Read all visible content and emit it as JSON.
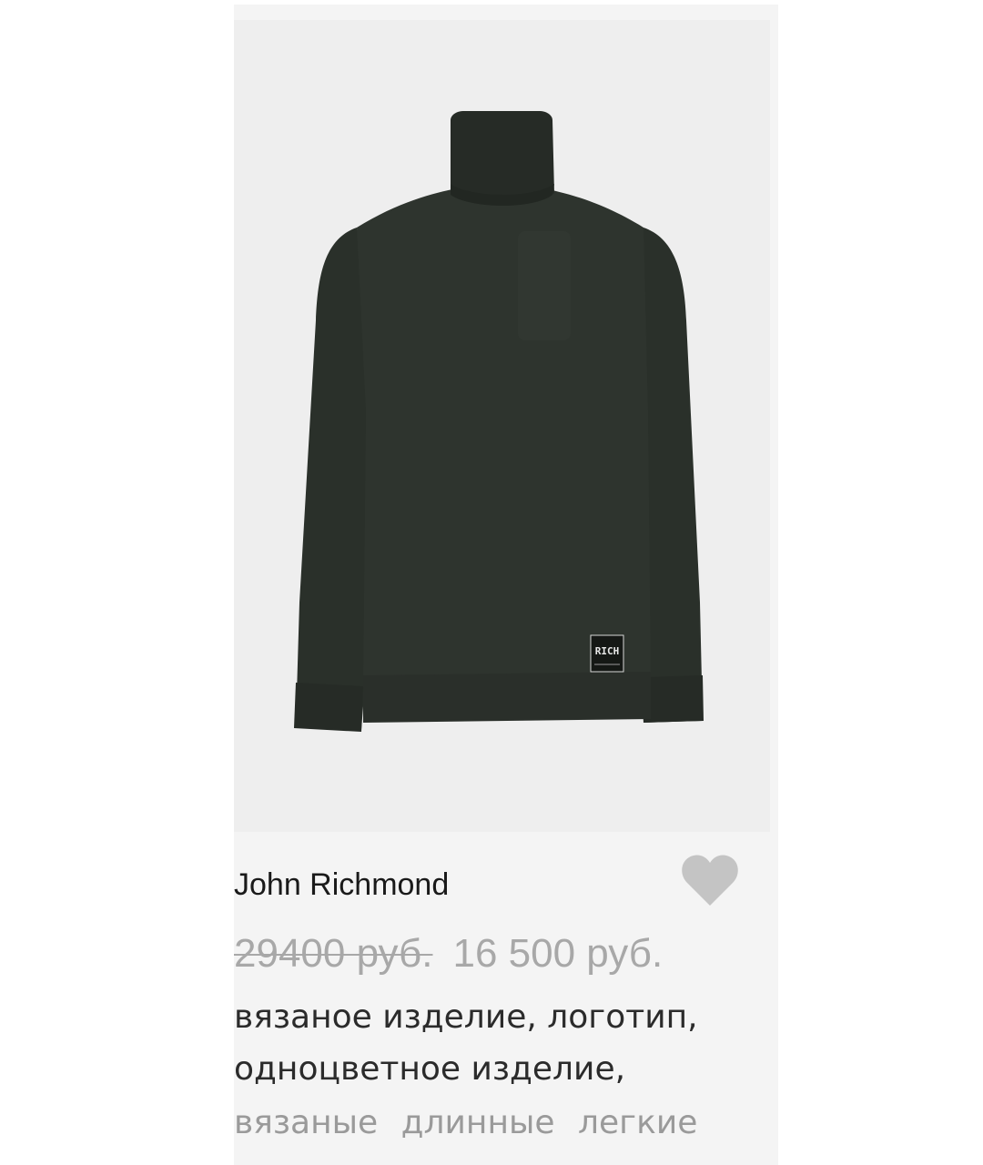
{
  "product": {
    "brand": "John Richmond",
    "old_price": "29400 руб.",
    "new_price": "16 500 руб.",
    "description_line1": "вязаное изделие, логотип,",
    "description_line2": "одноцветное изделие,",
    "description_line3": "вязаные длинные легкие",
    "image_label": "RICH"
  },
  "icons": {
    "favorite": "heart-icon"
  },
  "colors": {
    "sweater": "#2c322c",
    "card_background": "#f4f4f4",
    "photo_background": "#eeeeee",
    "heart": "#c4c4c4",
    "price_muted": "#a8a8a8"
  }
}
